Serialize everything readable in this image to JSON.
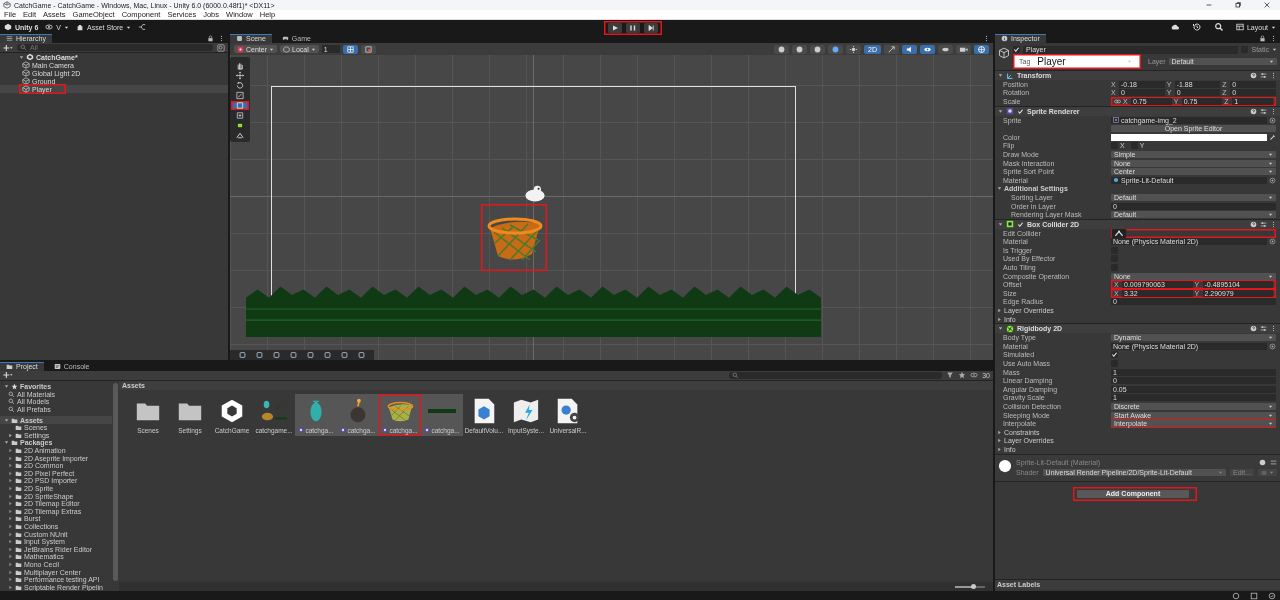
{
  "window": {
    "title": "CatchGame - CatchGame - Windows, Mac, Linux - Unity 6.0 (6000.0.48f1)* <DX11>"
  },
  "menu": [
    "File",
    "Edit",
    "Assets",
    "GameObject",
    "Component",
    "Services",
    "Jobs",
    "Window",
    "Help"
  ],
  "toolbar": {
    "account": "Unity 6",
    "version_control": "V",
    "asset_store": "Asset Store",
    "play_highlighted": true,
    "layout": "Layout"
  },
  "hierarchy": {
    "title": "Hierarchy",
    "search_placeholder": "All",
    "scene": {
      "name": "CatchGame*",
      "expanded": true,
      "children": [
        {
          "name": "Main Camera",
          "selected": false
        },
        {
          "name": "Global Light 2D",
          "selected": false
        },
        {
          "name": "Ground",
          "selected": false
        },
        {
          "name": "Player",
          "selected": true,
          "highlighted": true
        }
      ]
    }
  },
  "scene_view": {
    "tabs": [
      {
        "label": "Scene",
        "selected": true
      },
      {
        "label": "Game",
        "selected": false
      }
    ],
    "pivot": "Center",
    "space": "Local",
    "grid_step": "1",
    "mode_2d": {
      "label": "2D",
      "on": true
    },
    "tools": [
      {
        "kind": "hand",
        "selected": false
      },
      {
        "kind": "move",
        "selected": false
      },
      {
        "kind": "rotate",
        "selected": false
      },
      {
        "kind": "scale",
        "selected": false
      },
      {
        "kind": "rect",
        "selected": true,
        "highlighted": true
      },
      {
        "kind": "transform",
        "selected": false
      },
      {
        "kind": "collider",
        "selected": false
      },
      {
        "kind": "custom",
        "selected": false
      }
    ],
    "selection_highlighted": true
  },
  "inspector": {
    "title": "Inspector",
    "object": {
      "name": "Player",
      "active": true,
      "static_label": "Static",
      "static": false,
      "tag_label": "Tag",
      "tag": "Player",
      "tag_highlighted": true,
      "layer_label": "Layer",
      "layer": "Default"
    },
    "components": [
      {
        "kind": "transform",
        "name": "Transform",
        "rows": [
          {
            "kind": "vector3",
            "label": "Position",
            "fields": [
              {
                "axis": "X",
                "value": "-0.18"
              },
              {
                "axis": "Y",
                "value": "-1.88"
              },
              {
                "axis": "Z",
                "value": "0"
              }
            ]
          },
          {
            "kind": "vector3",
            "label": "Rotation",
            "fields": [
              {
                "axis": "X",
                "value": "0"
              },
              {
                "axis": "Y",
                "value": "0"
              },
              {
                "axis": "Z",
                "value": "0"
              }
            ]
          },
          {
            "kind": "vector3",
            "label": "Scale",
            "lock": true,
            "highlighted": true,
            "fields": [
              {
                "axis": "X",
                "value": "0.75"
              },
              {
                "axis": "Y",
                "value": "0.75"
              },
              {
                "axis": "Z",
                "value": "1"
              }
            ]
          }
        ]
      },
      {
        "kind": "sprite_renderer",
        "name": "Sprite Renderer",
        "enabled": true,
        "rows": [
          {
            "kind": "sprite",
            "label": "Sprite",
            "value": "catchgame-img_2"
          },
          {
            "kind": "button",
            "label": "Open Sprite Editor"
          },
          {
            "kind": "color",
            "label": "Color",
            "color": "#ffffff"
          },
          {
            "kind": "flip",
            "label": "Flip",
            "options": [
              {
                "label": "X",
                "checked": false
              },
              {
                "label": "Y",
                "checked": false
              }
            ]
          },
          {
            "kind": "dropdown",
            "label": "Draw Mode",
            "value": "Simple"
          },
          {
            "kind": "dropdown",
            "label": "Mask Interaction",
            "value": "None"
          },
          {
            "kind": "dropdown",
            "label": "Sprite Sort Point",
            "value": "Center"
          },
          {
            "kind": "material",
            "label": "Material",
            "value": "Sprite-Lit-Default"
          },
          {
            "kind": "header",
            "label": "Additional Settings",
            "expanded": true,
            "children": [
              {
                "kind": "dropdown",
                "label": "Sorting Layer",
                "value": "Default"
              },
              {
                "kind": "field",
                "label": "Order in Layer",
                "value": "0"
              },
              {
                "kind": "dropdown",
                "label": "Rendering Layer Mask",
                "value": "Default"
              }
            ]
          }
        ]
      },
      {
        "kind": "box_collider",
        "name": "Box Collider 2D",
        "enabled": true,
        "rows": [
          {
            "kind": "edit",
            "label": "Edit Collider",
            "highlighted": true
          },
          {
            "kind": "reference",
            "label": "Material",
            "value": "None (Physics Material 2D)"
          },
          {
            "kind": "checkbox",
            "label": "Is Trigger",
            "checked": false
          },
          {
            "kind": "checkbox",
            "label": "Used By Effector",
            "checked": false
          },
          {
            "kind": "checkbox",
            "label": "Auto Tiling",
            "checked": false
          },
          {
            "kind": "dropdown",
            "label": "Composite Operation",
            "value": "None"
          },
          {
            "kind": "vector2",
            "label": "Offset",
            "highlighted": true,
            "fields": [
              {
                "axis": "X",
                "value": "0.009790063"
              },
              {
                "axis": "Y",
                "value": "-0.4895104"
              }
            ]
          },
          {
            "kind": "vector2",
            "label": "Size",
            "highlighted": true,
            "fields": [
              {
                "axis": "X",
                "value": "3.32"
              },
              {
                "axis": "Y",
                "value": "2.290979"
              }
            ]
          },
          {
            "kind": "field",
            "label": "Edge Radius",
            "value": "0"
          },
          {
            "kind": "foldout",
            "label": "Layer Overrides",
            "expanded": false
          },
          {
            "kind": "foldout",
            "label": "Info",
            "expanded": false
          }
        ]
      },
      {
        "kind": "rigidbody",
        "name": "Rigidbody 2D",
        "rows": [
          {
            "kind": "dropdown",
            "label": "Body Type",
            "value": "Dynamic"
          },
          {
            "kind": "reference",
            "label": "Material",
            "value": "None (Physics Material 2D)"
          },
          {
            "kind": "checkbox",
            "label": "Simulated",
            "checked": true
          },
          {
            "kind": "checkbox",
            "label": "Use Auto Mass",
            "checked": false
          },
          {
            "kind": "field",
            "label": "Mass",
            "value": "1"
          },
          {
            "kind": "field",
            "label": "Linear Damping",
            "value": "0"
          },
          {
            "kind": "field",
            "label": "Angular Damping",
            "value": "0.05"
          },
          {
            "kind": "field",
            "label": "Gravity Scale",
            "value": "1"
          },
          {
            "kind": "dropdown",
            "label": "Collision Detection",
            "value": "Discrete"
          },
          {
            "kind": "dropdown",
            "label": "Sleeping Mode",
            "value": "Start Awake"
          },
          {
            "kind": "dropdown",
            "label": "Interpolate",
            "value": "Interpolate",
            "highlighted": true
          },
          {
            "kind": "foldout",
            "label": "Constraints",
            "expanded": false
          },
          {
            "kind": "foldout",
            "label": "Layer Overrides",
            "expanded": false
          },
          {
            "kind": "foldout",
            "label": "Info",
            "expanded": false
          }
        ]
      }
    ],
    "material": {
      "name": "Sprite-Lit-Default (Material)",
      "shader_label": "Shader",
      "shader": "Universal Render Pipeline/2D/Sprite-Lit-Default",
      "edit": "Edit..."
    },
    "add_component": {
      "label": "Add Component",
      "highlighted": true
    },
    "asset_labels": "Asset Labels"
  },
  "project": {
    "tabs": [
      {
        "label": "Project",
        "selected": true
      },
      {
        "label": "Console",
        "selected": false
      }
    ],
    "count": "30",
    "thumbnail_size": {
      "level": 0.6
    },
    "favorites": {
      "label": "Favorites",
      "expanded": true,
      "children": [
        "All Materials",
        "All Models",
        "All Prefabs"
      ]
    },
    "assets": {
      "label": "Assets",
      "expanded": true,
      "selected": true,
      "children": [
        {
          "label": "Scenes"
        },
        {
          "label": "Settings",
          "expanded": false
        }
      ]
    },
    "packages": {
      "label": "Packages",
      "expanded": true,
      "children": [
        "2D Animation",
        "2D Aseprite Importer",
        "2D Common",
        "2D Pixel Perfect",
        "2D PSD Importer",
        "2D Sprite",
        "2D SpriteShape",
        "2D Tilemap Editor",
        "2D Tilemap Extras",
        "Burst",
        "Collections",
        "Custom NUnit",
        "Input System",
        "JetBrains Rider Editor",
        "Mathematics",
        "Mono Cecil",
        "Multiplayer Center",
        "Performance testing API",
        "Scriptable Render Pipelin"
      ]
    },
    "breadcrumb": "Assets",
    "items": [
      {
        "kind": "folder",
        "label": "Scenes"
      },
      {
        "kind": "folder",
        "label": "Settings"
      },
      {
        "kind": "scene",
        "label": "CatchGame"
      },
      {
        "kind": "sheet",
        "label": "catchgame..."
      },
      {
        "kind": "fish",
        "label": "catchga..."
      },
      {
        "kind": "bomb",
        "label": "catchga..."
      },
      {
        "kind": "basket",
        "label": "catchga...",
        "highlighted": true
      },
      {
        "kind": "grass",
        "label": "catchga..."
      },
      {
        "kind": "volume",
        "label": "DefaultVolu..."
      },
      {
        "kind": "input",
        "label": "InputSyste..."
      },
      {
        "kind": "urp",
        "label": "UniversalR..."
      }
    ]
  }
}
